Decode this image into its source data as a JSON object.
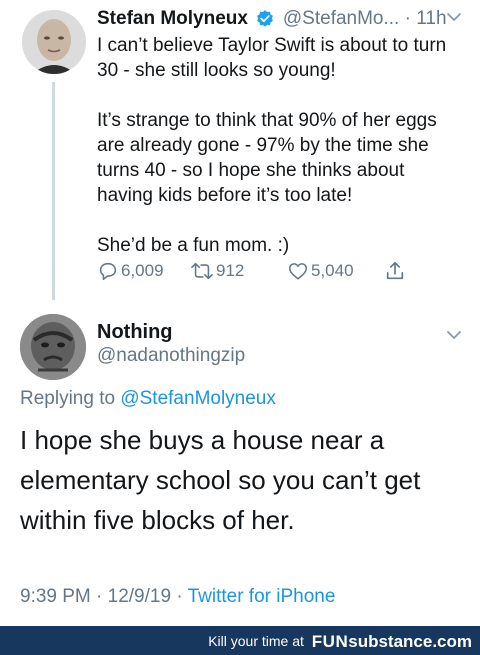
{
  "tweet": {
    "author": "Stefan Molyneux",
    "handle": "@StefanMo...",
    "time_sep": " · ",
    "time": "11h",
    "text": "I can’t believe Taylor Swift is about to turn 30 - she still looks so young!\n\nIt’s strange to think that 90% of her eggs are already gone - 97% by the time she turns 40 - so I hope she thinks about having kids before it’s too late!\n\nShe’d be a fun mom. :)",
    "replies": "6,009",
    "retweets": "912",
    "likes": "5,040",
    "verified_color": "#1da1f2"
  },
  "reply": {
    "author": "Nothing",
    "handle": "@nadanothingzip",
    "replying_prefix": "Replying to ",
    "replying_to": "@StefanMolyneux",
    "text": "I hope she buys a house near a elementary school so you can’t get within five blocks of her.",
    "timestamp": "9:39 PM · 12/9/19 · ",
    "source": "Twitter for iPhone"
  },
  "footer": {
    "tagline": "Kill your time at",
    "logo_fun": "FUN",
    "logo_rest": "substance.com",
    "bg_color": "#17375f"
  },
  "icons": {
    "reply": "reply-icon",
    "retweet": "retweet-icon",
    "like": "heart-icon",
    "share": "share-icon",
    "more": "chevron-down-icon",
    "verified": "verified-badge-icon"
  }
}
